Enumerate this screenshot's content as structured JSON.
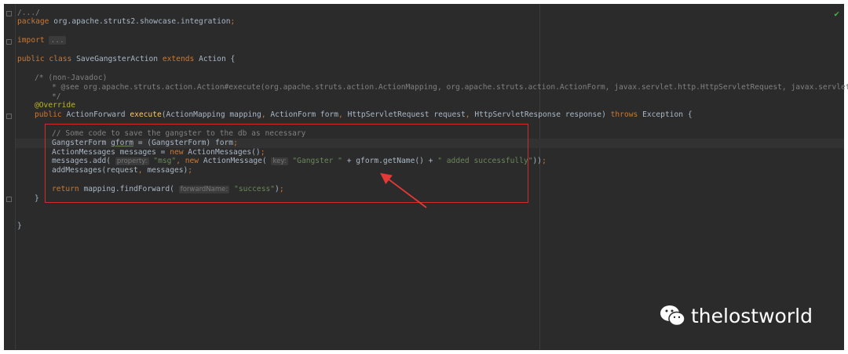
{
  "code_lines": [
    "/.../",
    "package org.apache.struts2.showcase.integration;",
    "import ...",
    "public class SaveGangsterAction extends Action {",
    "/* (non-Javadoc)",
    "* @see org.apache.struts.action.Action#execute(org.apache.struts.action.ActionMapping, org.apache.struts.action.ActionForm, javax.servlet.http.HttpServletRequest, javax.servlet.http",
    "*/",
    "@Override",
    "public ActionForward execute(ActionMapping mapping, ActionForm form, HttpServletRequest request, HttpServletResponse response) throws Exception {",
    "// Some code to save the gangster to the db as necessary",
    "GangsterForm gform = (GangsterForm) form;",
    "ActionMessages messages = new ActionMessages();",
    "messages.add( property: \"msg\", new ActionMessage( key: \"Gangster \" + gform.getName() + \" added successfully\"));",
    "addMessages(request, messages);",
    "return mapping.findForward( forwardName: \"success\");",
    "}",
    "}"
  ],
  "hints": {
    "property": "property:",
    "key": "key:",
    "forwardName": "forwardName:"
  },
  "watermark": "thelostworld",
  "colors": {
    "highlight_box": "#d12b2b",
    "background": "#2b2b2b"
  }
}
